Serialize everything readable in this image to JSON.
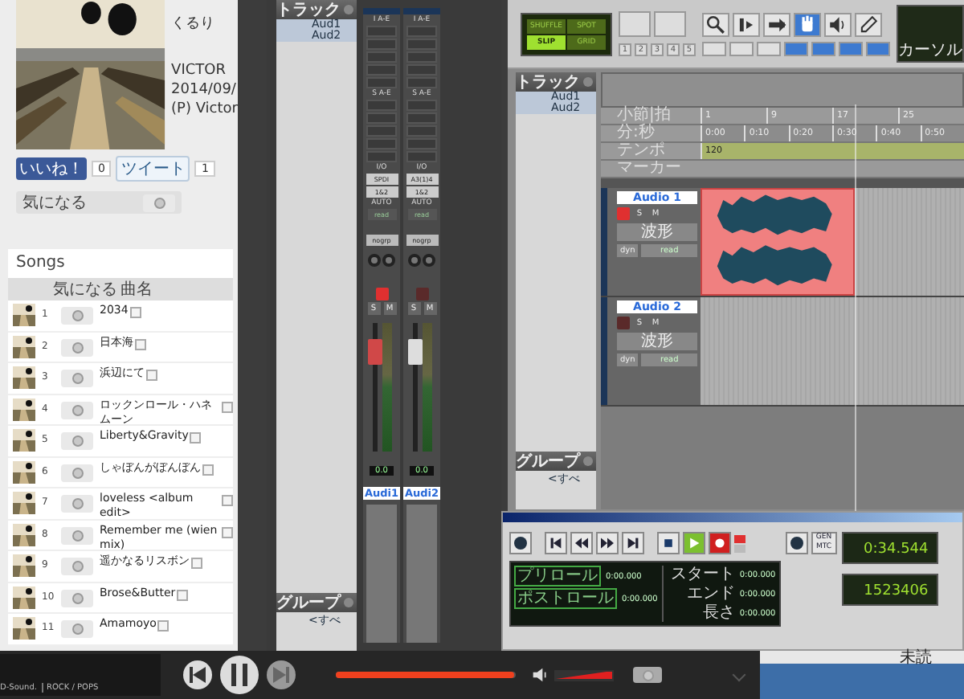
{
  "web": {
    "album": {
      "artist": "くるり",
      "label": "VICTOR",
      "date": "2014/09/",
      "copyright": "(P) Victor"
    },
    "like": {
      "label": "いいね！",
      "count": "0"
    },
    "tweet": {
      "label": "ツイート",
      "count": "1"
    },
    "favorite": "気になる"
  },
  "songs": {
    "title": "Songs",
    "columns": [
      "気になる",
      "曲名"
    ],
    "rows": [
      {
        "number": "1",
        "title": "2034"
      },
      {
        "number": "2",
        "title": "日本海"
      },
      {
        "number": "3",
        "title": "浜辺にて"
      },
      {
        "number": "4",
        "title": "ロックンロール・ハネムーン"
      },
      {
        "number": "5",
        "title": "Liberty&Gravity"
      },
      {
        "number": "6",
        "title": "しゃぼんがぼんぼん"
      },
      {
        "number": "7",
        "title": "loveless <album edit>"
      },
      {
        "number": "8",
        "title": "Remember me (wien mix)"
      },
      {
        "number": "9",
        "title": "遥かなるリスボン"
      },
      {
        "number": "10",
        "title": "Brose&Butter"
      },
      {
        "number": "11",
        "title": "Amamoyo"
      }
    ]
  },
  "mix_window": {
    "tracks_title": "トラック",
    "tracks": [
      "Aud1",
      "Aud2"
    ],
    "groups_title": "グループ",
    "groups": [
      "<すべ"
    ],
    "channels": [
      {
        "insert": "I A-E",
        "send": "S A-E",
        "io": "I/O",
        "input": "SPDI",
        "output": "1&2",
        "auto": "AUTO",
        "mode": "read",
        "group": "nogrp",
        "solo": "S",
        "mute": "M",
        "volume": "0.0",
        "name": "Audi1",
        "record_armed": true
      },
      {
        "insert": "I A-E",
        "send": "S A-E",
        "io": "I/O",
        "input": "A3(1)4",
        "output": "1&2",
        "auto": "AUTO",
        "mode": "read",
        "group": "nogrp",
        "solo": "S",
        "mute": "M",
        "volume": "0.0",
        "name": "Audi2",
        "record_armed": false
      }
    ]
  },
  "edit_window": {
    "modes": [
      {
        "label": "SHUFFLE",
        "selected": false
      },
      {
        "label": "SPOT",
        "selected": false
      },
      {
        "label": "SLIP",
        "selected": true
      },
      {
        "label": "GRID",
        "selected": false
      }
    ],
    "zoom_presets": [
      "1",
      "2",
      "3",
      "4",
      "5"
    ],
    "tools": [
      {
        "kind": "zoom",
        "selected": false
      },
      {
        "kind": "trim",
        "selected": false
      },
      {
        "kind": "select",
        "selected": false
      },
      {
        "kind": "grab",
        "selected": true
      },
      {
        "kind": "scrub",
        "selected": false
      },
      {
        "kind": "pencil",
        "selected": false
      }
    ],
    "counter_label": "カーソル",
    "tracks_title": "トラック",
    "tracks": [
      "Aud1",
      "Aud2"
    ],
    "groups_title": "グループ",
    "groups": [
      "<すべ"
    ],
    "rulers": [
      {
        "label": "小節|拍",
        "marks": [
          "1",
          "9",
          "17",
          "25"
        ]
      },
      {
        "label": "分:秒",
        "marks": [
          "0:00",
          "0:10",
          "0:20",
          "0:30",
          "0:40",
          "0:50"
        ]
      },
      {
        "label": "テンポ",
        "marks": [
          "120"
        ]
      },
      {
        "label": "マーカー"
      }
    ],
    "tracks_edit": [
      {
        "name": "Audio 1",
        "record_armed": true,
        "solo": "S",
        "mute": "M",
        "view": "波形",
        "dyn": "dyn",
        "mode": "read",
        "clip": {
          "kind": "audio"
        }
      },
      {
        "name": "Audio 2",
        "record_armed": false,
        "solo": "S",
        "mute": "M",
        "view": "波形",
        "dyn": "dyn",
        "mode": "read"
      }
    ]
  },
  "transport": {
    "playing": true,
    "preroll_label": "プリロール",
    "preroll": "0:00.000",
    "postroll_label": "ポストロール",
    "postroll": "0:00.000",
    "start_label": "スタート",
    "start": "0:00.000",
    "end_label": "エンド",
    "end": "0:00.000",
    "length_label": "長さ",
    "length": "0:00.000",
    "gen": "GEN",
    "mtc": "MTC",
    "main_counter": "0:34.544",
    "sub_counter": "1523406"
  },
  "player": {
    "source": "D-Sound.",
    "genre": "ROCK / POPS",
    "playing": true,
    "progress": {
      "level": 0.99
    },
    "volume": {
      "level": 1
    }
  },
  "taskbar": {
    "text": "未読"
  }
}
